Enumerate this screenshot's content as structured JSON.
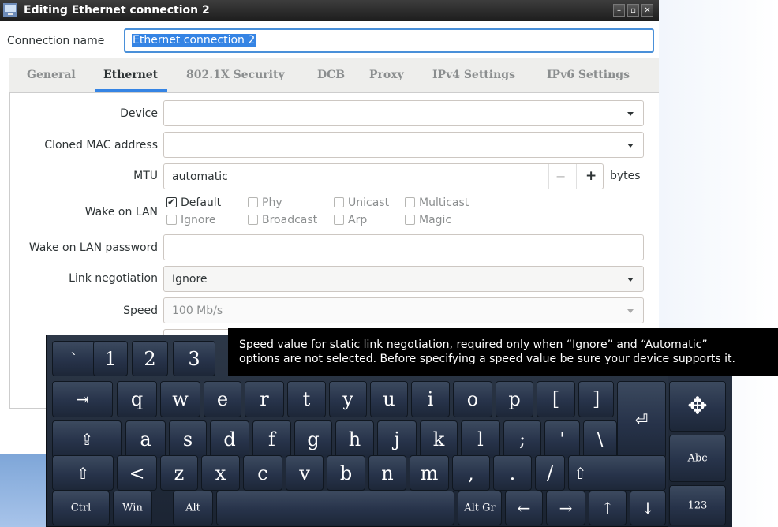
{
  "window": {
    "title": "Editing Ethernet connection 2",
    "buttons": [
      "minimize",
      "maximize",
      "close"
    ]
  },
  "connection": {
    "label": "Connection name",
    "value": "Ethernet connection 2"
  },
  "tabs": [
    {
      "label": "General",
      "active": false
    },
    {
      "label": "Ethernet",
      "active": true
    },
    {
      "label": "802.1X Security",
      "active": false
    },
    {
      "label": "DCB",
      "active": false
    },
    {
      "label": "Proxy",
      "active": false
    },
    {
      "label": "IPv4 Settings",
      "active": false
    },
    {
      "label": "IPv6 Settings",
      "active": false
    }
  ],
  "form": {
    "device_label": "Device",
    "device_value": "",
    "cloned_mac_label": "Cloned MAC address",
    "cloned_mac_value": "",
    "mtu_label": "MTU",
    "mtu_value": "automatic",
    "mtu_minus": "−",
    "mtu_plus": "+",
    "mtu_unit": "bytes",
    "wol_label": "Wake on LAN",
    "wol_options": [
      {
        "label": "Default",
        "checked": true
      },
      {
        "label": "Phy",
        "checked": false
      },
      {
        "label": "Unicast",
        "checked": false
      },
      {
        "label": "Multicast",
        "checked": false
      },
      {
        "label": "Ignore",
        "checked": false
      },
      {
        "label": "Broadcast",
        "checked": false
      },
      {
        "label": "Arp",
        "checked": false
      },
      {
        "label": "Magic",
        "checked": false
      }
    ],
    "wol_password_label": "Wake on LAN password",
    "wol_password_value": "",
    "link_negotiation_label": "Link negotiation",
    "link_negotiation_value": "Ignore",
    "speed_label": "Speed",
    "speed_value": "100 Mb/s"
  },
  "tooltip": {
    "line1": "Speed value for static link negotiation, required only when “Ignore” and “Automatic”",
    "line2": "options are not selected. Before specifying a speed value be sure your device supports it."
  },
  "keyboard": {
    "row1": [
      "`",
      "1",
      "2",
      "3"
    ],
    "row2": [
      "⇥",
      "q",
      "w",
      "e",
      "r",
      "t",
      "y",
      "u",
      "i",
      "o",
      "p",
      "[",
      "]"
    ],
    "row3": [
      "⇪",
      "a",
      "s",
      "d",
      "f",
      "g",
      "h",
      "j",
      "k",
      "l",
      ";",
      "'",
      "\\"
    ],
    "row4": [
      "⇧",
      "<",
      "z",
      "x",
      "c",
      "v",
      "b",
      "n",
      "m",
      ",",
      ".",
      "/",
      "⇧"
    ],
    "row5": [
      "Ctrl",
      "Win",
      "Alt",
      "",
      "Alt Gr",
      "←",
      "→",
      "↑",
      "↓"
    ],
    "enter": "⏎",
    "side": [
      "✥",
      "Abc",
      "123"
    ]
  },
  "colors": {
    "accent": "#3584e4",
    "titlebar": "#2a2a2a",
    "keyboard_bg": "#1f2838",
    "tooltip_bg": "#000000"
  }
}
